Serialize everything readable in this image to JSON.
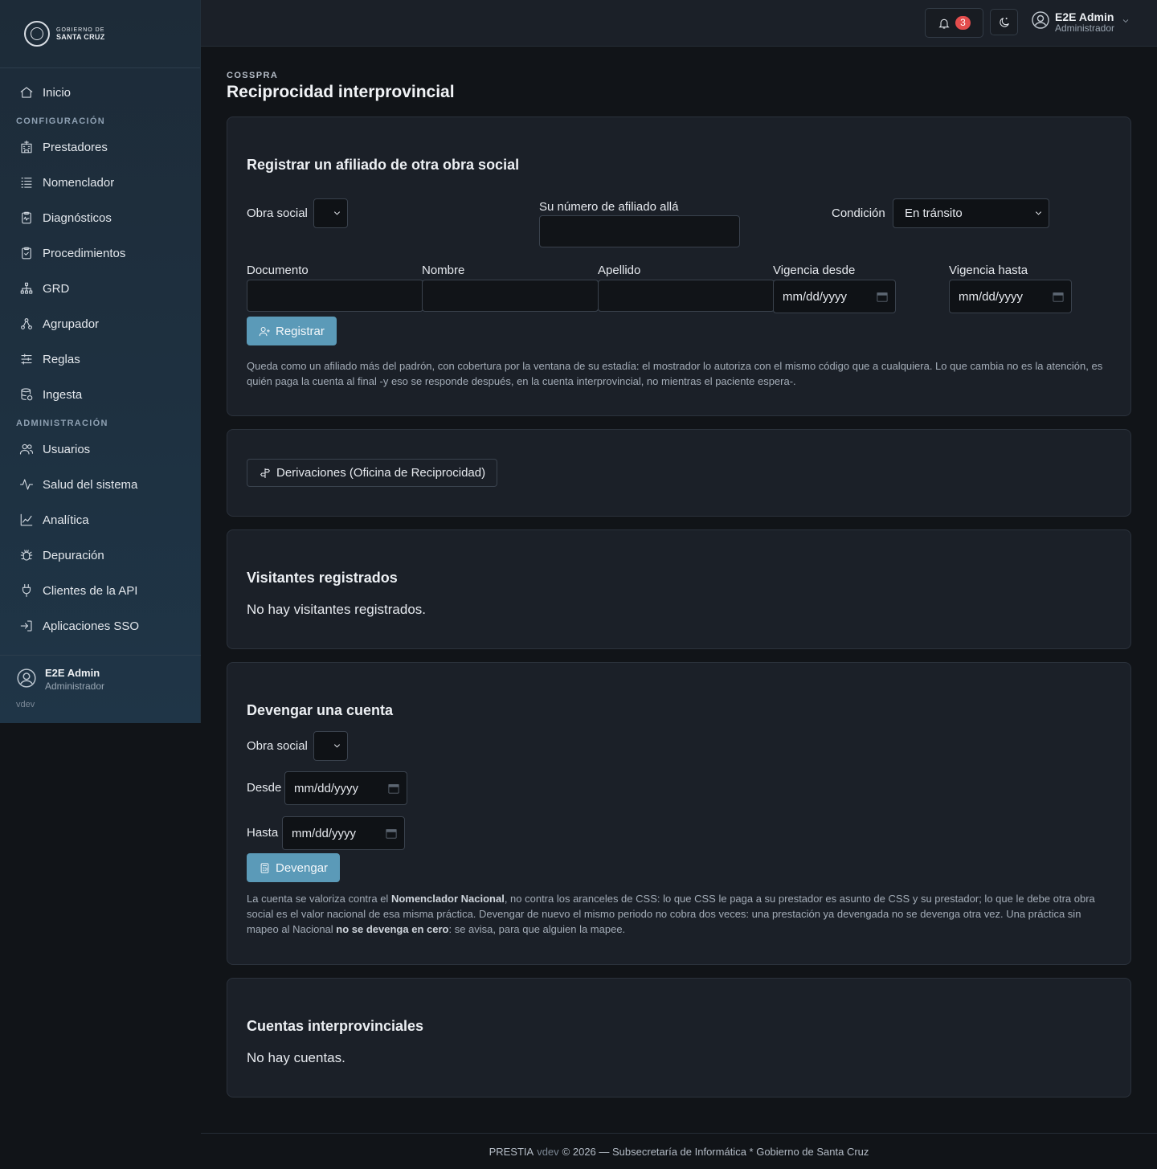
{
  "brand": {
    "line1": "GOBIERNO DE",
    "line2": "SANTA CRUZ"
  },
  "sidebar": {
    "items_top": [
      {
        "label": "Inicio",
        "icon": "home-icon"
      }
    ],
    "section_config": "CONFIGURACIÓN",
    "items_config": [
      {
        "label": "Prestadores",
        "icon": "hospital-icon"
      },
      {
        "label": "Nomenclador",
        "icon": "list-icon"
      },
      {
        "label": "Diagnósticos",
        "icon": "clipboard-pulse-icon"
      },
      {
        "label": "Procedimientos",
        "icon": "clipboard-check-icon"
      },
      {
        "label": "GRD",
        "icon": "hierarchy-icon"
      },
      {
        "label": "Agrupador",
        "icon": "diagram-icon"
      },
      {
        "label": "Reglas",
        "icon": "sliders-icon"
      },
      {
        "label": "Ingesta",
        "icon": "database-icon"
      }
    ],
    "section_admin": "ADMINISTRACIÓN",
    "items_admin": [
      {
        "label": "Usuarios",
        "icon": "users-icon"
      },
      {
        "label": "Salud del sistema",
        "icon": "activity-icon"
      },
      {
        "label": "Analítica",
        "icon": "chart-line-icon"
      },
      {
        "label": "Depuración",
        "icon": "bug-icon"
      },
      {
        "label": "Clientes de la API",
        "icon": "plug-icon"
      },
      {
        "label": "Aplicaciones SSO",
        "icon": "login-icon"
      }
    ],
    "user": {
      "name": "E2E Admin",
      "role": "Administrador",
      "version": "vdev"
    }
  },
  "topbar": {
    "notifications": "3",
    "user_name": "E2E Admin",
    "user_role": "Administrador"
  },
  "page": {
    "eyebrow": "COSSPRA",
    "title": "Reciprocidad interprovincial"
  },
  "register": {
    "title": "Registrar un afiliado de otra obra social",
    "obra_social_label": "Obra social",
    "afiliado_label": "Su número de afiliado allá",
    "condicion_label": "Condición",
    "condicion_value": "En tránsito",
    "documento_label": "Documento",
    "nombre_label": "Nombre",
    "apellido_label": "Apellido",
    "vig_desde_label": "Vigencia desde",
    "vig_hasta_label": "Vigencia hasta",
    "date_placeholder": "mm/dd/yyyy",
    "button": "Registrar",
    "help": "Queda como un afiliado más del padrón, con cobertura por la ventana de su estadía: el mostrador lo autoriza con el mismo código que a cualquiera. Lo que cambia no es la atención, es quién paga la cuenta al final -y eso se responde después, en la cuenta interprovincial, no mientras el paciente espera-."
  },
  "derivaciones": {
    "button": "Derivaciones (Oficina de Reciprocidad)"
  },
  "visitantes": {
    "title": "Visitantes registrados",
    "empty": "No hay visitantes registrados."
  },
  "devengar": {
    "title": "Devengar una cuenta",
    "obra_social_label": "Obra social",
    "desde_label": "Desde",
    "hasta_label": "Hasta",
    "date_placeholder": "mm/dd/yyyy",
    "button": "Devengar",
    "help_1": "La cuenta se valoriza contra el ",
    "help_b1": "Nomenclador Nacional",
    "help_2": ", no contra los aranceles de CSS: lo que CSS le paga a su prestador es asunto de CSS y su prestador; lo que le debe otra obra social es el valor nacional de esa misma práctica. Devengar de nuevo el mismo periodo no cobra dos veces: una prestación ya devengada no se devenga otra vez. Una práctica sin mapeo al Nacional ",
    "help_b2": "no se devenga en cero",
    "help_3": ": se avisa, para que alguien la mapee."
  },
  "cuentas": {
    "title": "Cuentas interprovinciales",
    "empty": "No hay cuentas."
  },
  "footer": {
    "app": "PRESTIA",
    "version": "vdev",
    "rest": "© 2026 — Subsecretaría de Informática * Gobierno de Santa Cruz"
  }
}
